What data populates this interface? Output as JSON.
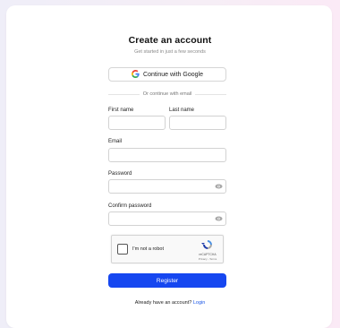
{
  "header": {
    "title": "Create an account",
    "subtitle": "Get started in just a few seconds"
  },
  "google": {
    "label": "Continue with Google",
    "icon": "google-icon"
  },
  "divider": {
    "text": "Or continue with email"
  },
  "fields": {
    "first_name": {
      "label": "First name",
      "value": ""
    },
    "last_name": {
      "label": "Last name",
      "value": ""
    },
    "email": {
      "label": "Email",
      "value": ""
    },
    "password": {
      "label": "Password",
      "value": "",
      "icon": "eye-icon"
    },
    "confirm_password": {
      "label": "Confirm password",
      "value": "",
      "icon": "eye-icon"
    }
  },
  "captcha": {
    "label": "I'm not a robot",
    "brand": "reCAPTCHA",
    "terms": "Privacy - Terms"
  },
  "register": {
    "label": "Register",
    "color": "#1647f0"
  },
  "footer": {
    "prompt": "Already have an account?",
    "link": "Login",
    "link_color": "#1b57e6"
  }
}
